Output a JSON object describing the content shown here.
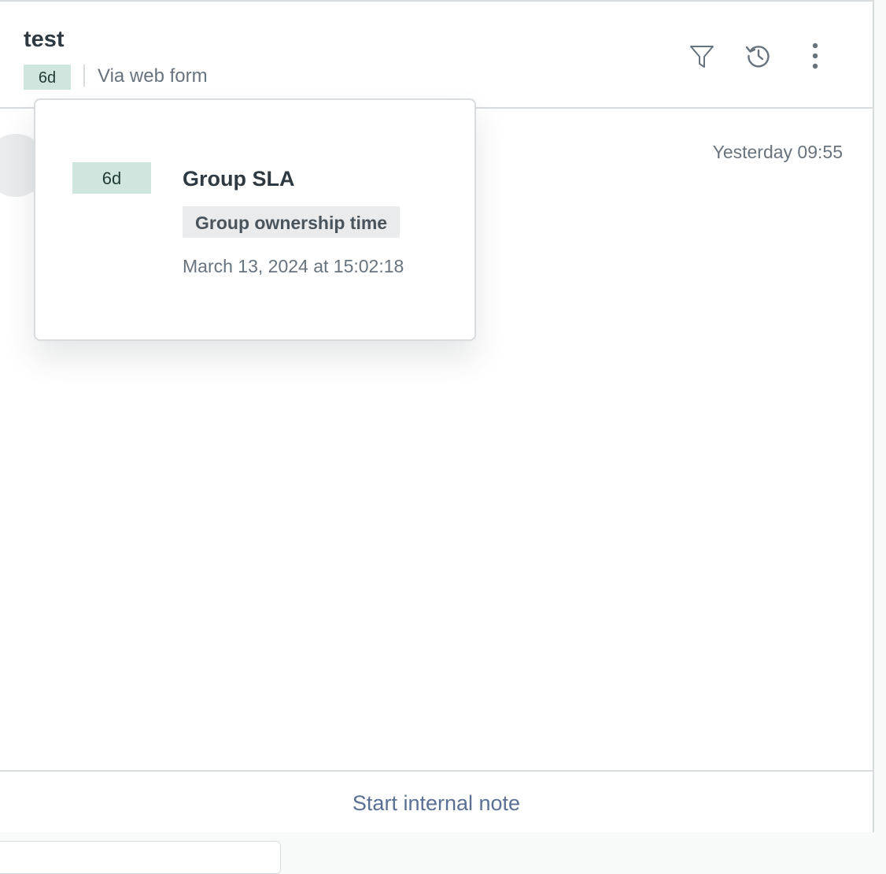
{
  "ticket": {
    "title": "test",
    "sla_badge": "6d",
    "channel": "Via web form"
  },
  "toolbar": {
    "icons": [
      "filter-icon",
      "history-icon",
      "more-vertical-icon"
    ]
  },
  "conversation": {
    "timestamp": "Yesterday 09:55"
  },
  "sla_popover": {
    "badge": "6d",
    "title": "Group SLA",
    "metric": "Group ownership time",
    "date": "March 13, 2024 at 15:02:18"
  },
  "composer": {
    "start_internal_note": "Start internal note"
  },
  "colors": {
    "sla_badge_bg": "#d1e5df",
    "link": "#5a7094",
    "border": "#d8dcde"
  }
}
